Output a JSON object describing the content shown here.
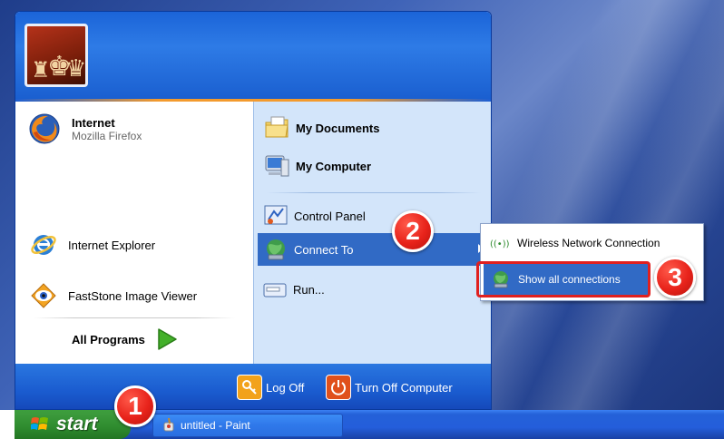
{
  "start_menu": {
    "pinned": [
      {
        "label": "Internet",
        "sub": "Mozilla Firefox",
        "icon": "firefox-icon"
      },
      {
        "label": "Internet Explorer",
        "icon": "internet-explorer-icon"
      },
      {
        "label": "FastStone Image Viewer",
        "icon": "faststone-icon"
      }
    ],
    "all_programs": "All Programs",
    "right": {
      "my_documents": "My Documents",
      "my_computer": "My Computer",
      "control_panel": "Control Panel",
      "connect_to": "Connect To",
      "run": "Run..."
    },
    "footer": {
      "log_off": "Log Off",
      "turn_off": "Turn Off Computer"
    }
  },
  "submenu": {
    "items": [
      {
        "label": "Wireless Network Connection",
        "icon": "wireless-icon"
      },
      {
        "label": "Show all connections",
        "icon": "network-globe-icon"
      }
    ]
  },
  "badges": [
    "1",
    "2",
    "3"
  ],
  "taskbar": {
    "start_label": "start",
    "task": "untitled - Paint"
  },
  "colors": {
    "highlight": "#316ac5",
    "badge_red": "#e8231b",
    "start_green": "#2e8b2e",
    "taskbar_blue": "#245edb"
  }
}
